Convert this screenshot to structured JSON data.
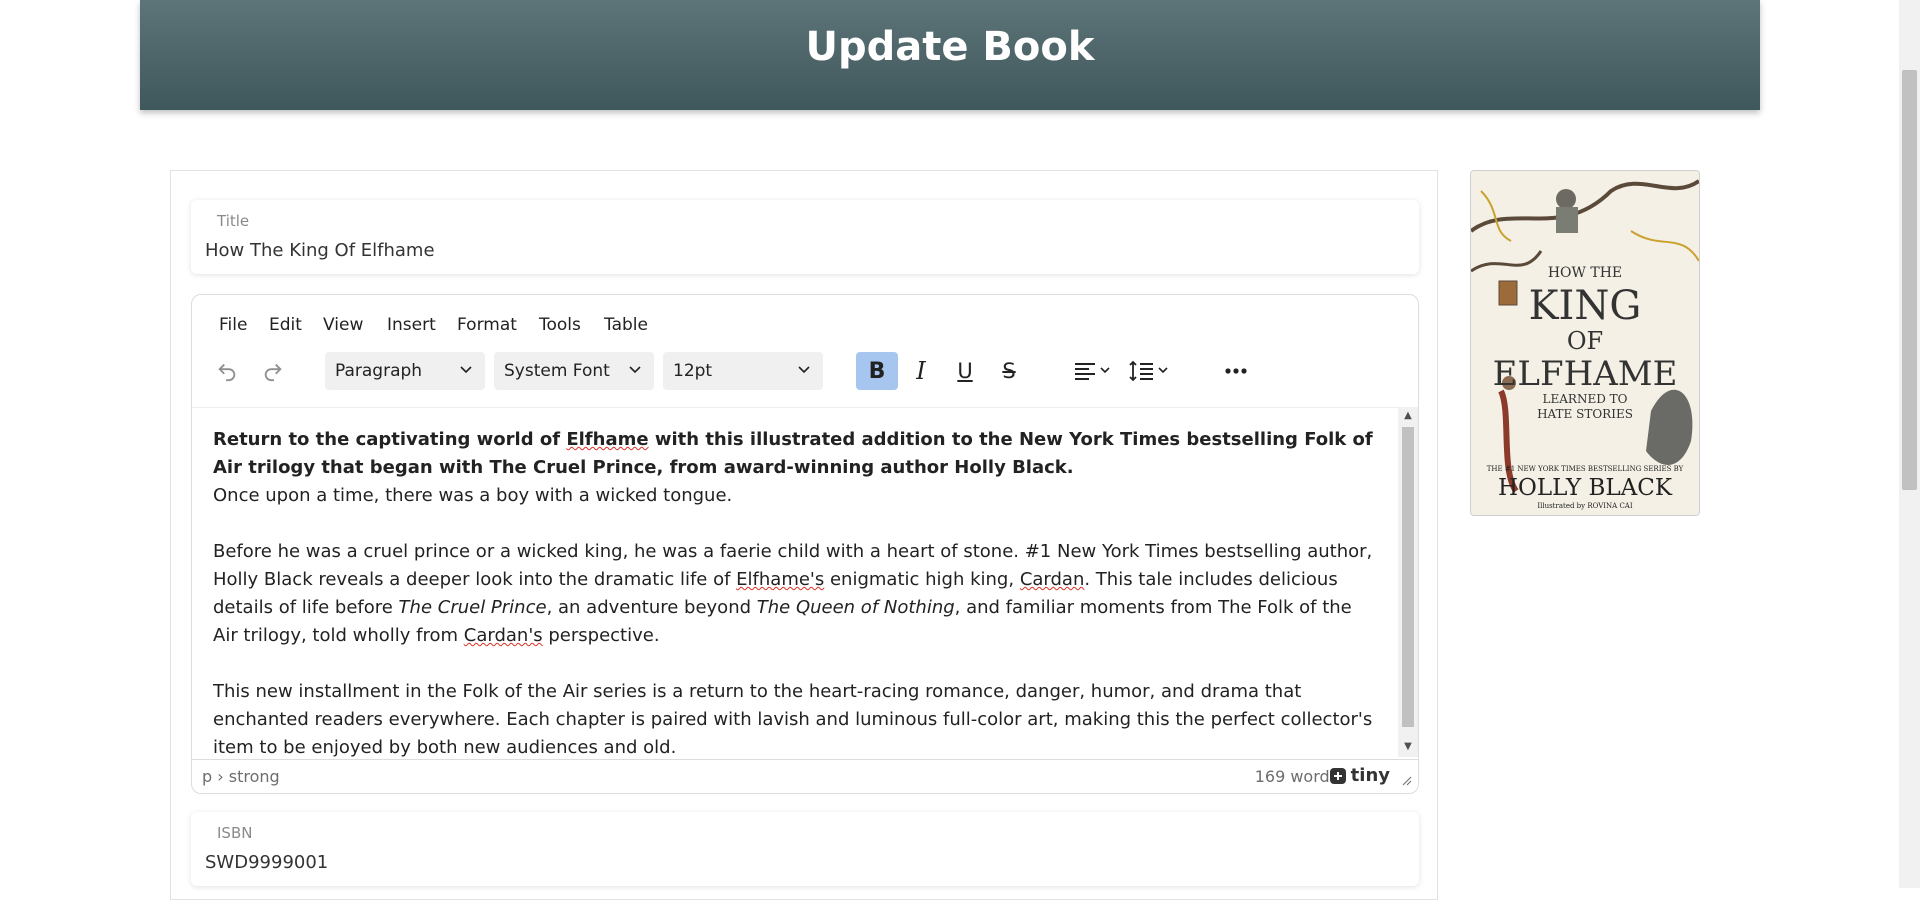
{
  "header": {
    "title": "Update Book"
  },
  "form": {
    "title": {
      "label": "Title",
      "value": "How The King Of Elfhame"
    },
    "isbn": {
      "label": "ISBN",
      "value": "SWD9999001"
    }
  },
  "editor": {
    "menu": [
      "File",
      "Edit",
      "View",
      "Insert",
      "Format",
      "Tools",
      "Table"
    ],
    "toolbar": {
      "block_format": "Paragraph",
      "font_family": "System Font",
      "font_size": "12pt"
    },
    "content": {
      "intro_a": "Return to the captivating world of ",
      "intro_elfhame": "Elfhame",
      "intro_b": " with this illustrated addition to the New York Times bestselling Folk of Air trilogy that began with The Cruel Prince, from award-winning author Holly Black.",
      "line2": "Once upon a time, there was a boy with a wicked tongue.",
      "p2_a": "Before he was a cruel prince or a wicked king, he was a faerie child with a heart of stone. #1 New York Times bestselling author, Holly Black reveals a deeper look into the dramatic life of ",
      "p2_elfhames": "Elfhame's",
      "p2_b": " enigmatic high king, ",
      "p2_cardan": "Cardan",
      "p2_c": ". This tale includes delicious details of life before ",
      "p2_cruel": "The Cruel Prince",
      "p2_d": ", an adventure beyond ",
      "p2_queen": "The Queen of Nothing",
      "p2_e": ", and familiar moments from The Folk of the Air trilogy, told wholly from ",
      "p2_cardans": "Cardan's",
      "p2_f": " perspective.",
      "p3": "This new installment in the Folk of the Air series is a return to the heart-racing romance, danger, humor, and drama that enchanted readers everywhere. Each chapter is paired with lavish and luminous full-color art, making this the perfect collector's item to be enjoyed by both new audiences and old."
    },
    "status": {
      "path": "p › strong",
      "word_count": "169 words",
      "brand": "tiny"
    }
  },
  "cover": {
    "line1": "HOW THE",
    "line2": "KING",
    "line3": "OF",
    "line4": "ELFHAME",
    "line5": "LEARNED TO",
    "line6": "HATE STORIES",
    "series": "THE #1 NEW YORK TIMES BESTSELLING SERIES BY",
    "author": "HOLLY BLACK",
    "illustrator": "Illustrated by ROVINA CAI"
  }
}
